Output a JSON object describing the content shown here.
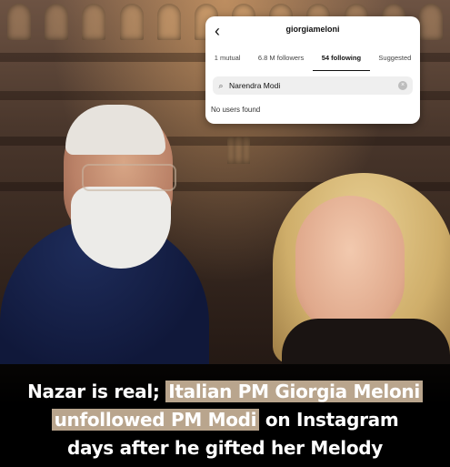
{
  "instagram": {
    "username": "giorgiameloni",
    "tabs": [
      "1 mutual",
      "6.8 M followers",
      "54 following",
      "Suggested"
    ],
    "active_tab": "54 following",
    "search_value": "Narendra Modi",
    "empty_message": "No users found"
  },
  "caption": {
    "line1_plain": "Nazar is real;",
    "line1_highlight": "Italian PM Giorgia Meloni",
    "line2_highlight": "unfollowed PM Modi",
    "line2_plain": "on Instagram",
    "line3": "days after he gifted her Melody"
  },
  "colors": {
    "highlight": "#b9a58d",
    "caption_text": "#ffffff",
    "caption_bg": "#000000"
  }
}
